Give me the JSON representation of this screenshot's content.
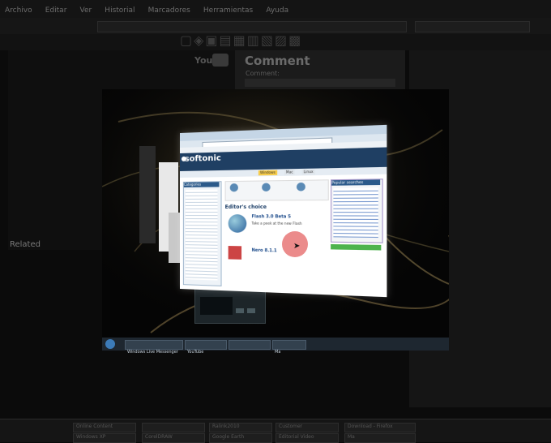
{
  "browser": {
    "menu": [
      "Archivo",
      "Editar",
      "Ver",
      "Historial",
      "Marcadores",
      "Herramientas",
      "Ayuda"
    ]
  },
  "youtube": {
    "logo_you": "You",
    "comment_title": "Comment",
    "comment_label": "Comment:",
    "related_label": "Related"
  },
  "screencast": {
    "site_logo": "softonic",
    "section_editors": "Editor's choice",
    "product1_name": "Flash 3.0 Beta 5",
    "product1_desc": "Take a peek at the new Flash",
    "product2_name": "Nero 8.1.1",
    "sidebar_title": "Categories",
    "right_title": "Popular searches",
    "vista_taskbar_buttons": [
      "Windows Live Messenger",
      "YouTube",
      "",
      "Ma"
    ],
    "nav_tabs": [
      "Windows",
      "Mac",
      "Linux"
    ]
  },
  "host_taskbar": {
    "row1": [
      "",
      "Online Content",
      "",
      "Ralink2010",
      "Customer",
      "Download - Firefox"
    ],
    "row2": [
      "",
      "Windows XP",
      "CorelDRAW",
      "Google Earth",
      "Editorial Video",
      "Ma"
    ]
  },
  "colors": {
    "cursor_highlight": "#e66e6e",
    "softonic_header": "#1f3f63"
  }
}
